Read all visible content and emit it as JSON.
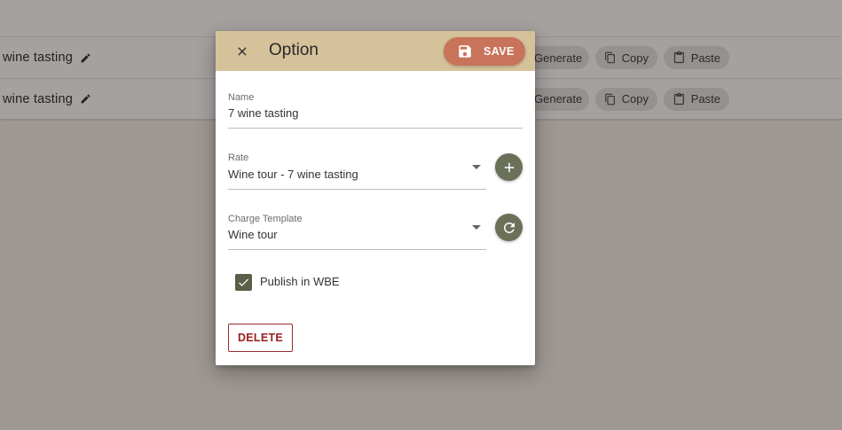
{
  "background": {
    "rows": [
      {
        "title": "wine tasting",
        "generate": "Generate",
        "copy": "Copy",
        "paste": "Paste"
      },
      {
        "title": "wine tasting",
        "generate": "Generate",
        "copy": "Copy",
        "paste": "Paste"
      }
    ]
  },
  "dialog": {
    "title": "Option",
    "save_label": "SAVE",
    "fields": {
      "name": {
        "label": "Name",
        "value": "7 wine tasting"
      },
      "rate": {
        "label": "Rate",
        "value": "Wine tour - 7 wine tasting"
      },
      "charge_template": {
        "label": "Charge Template",
        "value": "Wine tour"
      }
    },
    "publish": {
      "label": "Publish in WBE",
      "checked": true
    },
    "delete_label": "DELETE"
  },
  "colors": {
    "header": "#d6c29a",
    "save": "#c9735a",
    "round_button": "#6b7159",
    "delete": "#9a2020"
  },
  "icons": {
    "close": "close-icon",
    "save": "floppy-disk-icon",
    "add": "plus-icon",
    "refresh": "refresh-icon",
    "edit": "pencil-icon",
    "copy": "copy-icon",
    "paste": "clipboard-icon"
  }
}
